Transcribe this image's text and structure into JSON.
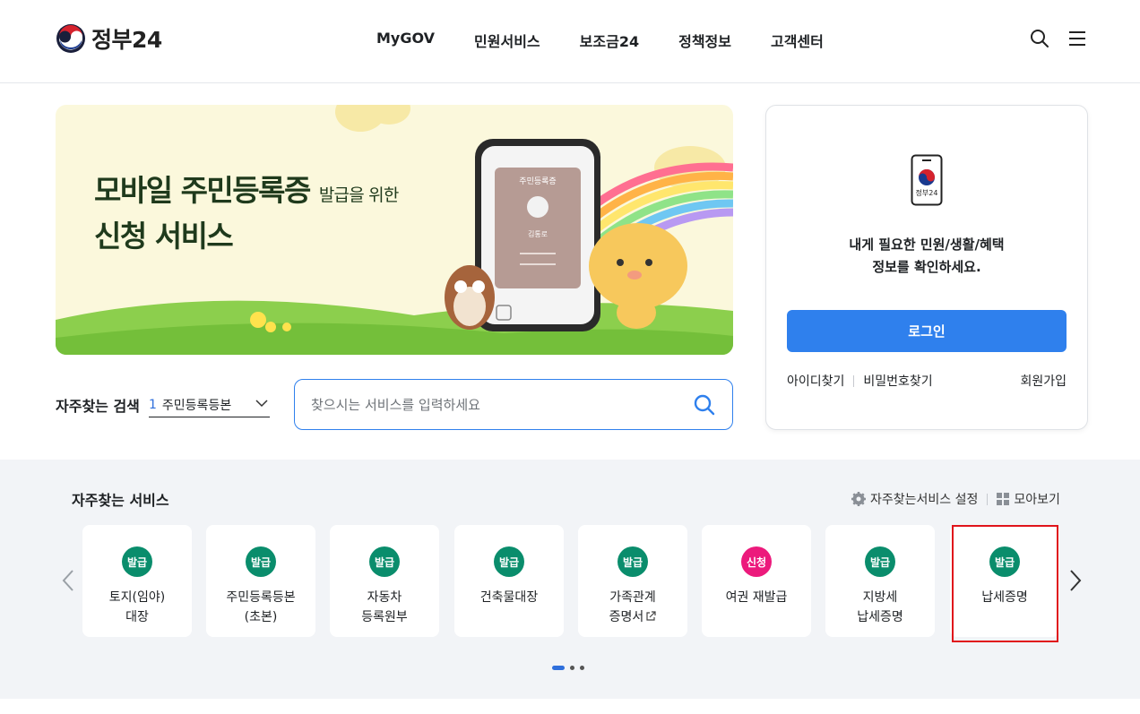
{
  "header": {
    "logo_text": "정부24",
    "nav": [
      "MyGOV",
      "민원서비스",
      "보조금24",
      "정책정보",
      "고객센터"
    ]
  },
  "banner": {
    "title_line1": "모바일 주민등록증",
    "title_line1_small": "발급을 위한",
    "title_line2": "신청 서비스",
    "card_title": "주민등록증",
    "card_name": "김통로"
  },
  "login": {
    "phone_label": "정부24",
    "message_line1": "내게 필요한 민원/생활/혜택",
    "message_line2": "정보를 확인하세요.",
    "login_button": "로그인",
    "find_id": "아이디찾기",
    "find_pw": "비밀번호찾기",
    "signup": "회원가입"
  },
  "search": {
    "fav_label": "자주찾는 검색",
    "select_num": "1",
    "select_value": "주민등록등본",
    "placeholder": "찾으시는 서비스를 입력하세요"
  },
  "favorites": {
    "title": "자주찾는 서비스",
    "settings_label": "자주찾는서비스 설정",
    "view_all_label": "모아보기",
    "items": [
      {
        "badge": "발급",
        "line1": "토지(임야)",
        "line2": "대장"
      },
      {
        "badge": "발급",
        "line1": "주민등록등본",
        "line2": "(초본)"
      },
      {
        "badge": "발급",
        "line1": "자동차",
        "line2": "등록원부"
      },
      {
        "badge": "발급",
        "line1": "건축물대장",
        "line2": ""
      },
      {
        "badge": "발급",
        "line1": "가족관계",
        "line2": "증명서"
      },
      {
        "badge": "신청",
        "line1": "여권 재발급",
        "line2": ""
      },
      {
        "badge": "발급",
        "line1": "지방세",
        "line2": "납세증명"
      },
      {
        "badge": "발급",
        "line1": "납세증명",
        "line2": ""
      }
    ]
  },
  "colors": {
    "primary": "#2f80ed",
    "badge_green": "#0a8d6c",
    "badge_pink": "#ec1a7c",
    "highlight_red": "#e0141b"
  }
}
